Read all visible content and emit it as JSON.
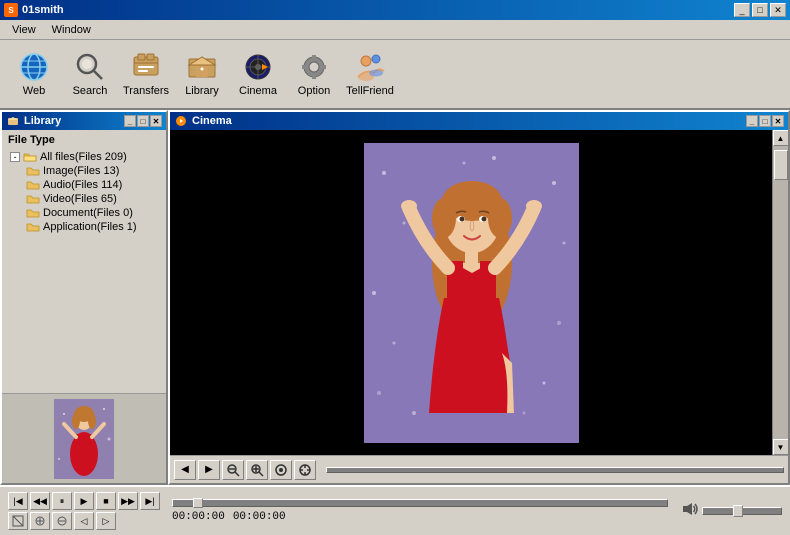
{
  "app": {
    "title": "01smith",
    "title_icon": "S"
  },
  "title_controls": {
    "minimize": "_",
    "maximize": "□",
    "close": "✕"
  },
  "menu": {
    "items": [
      {
        "id": "view",
        "label": "View"
      },
      {
        "id": "window",
        "label": "Window"
      }
    ]
  },
  "toolbar": {
    "buttons": [
      {
        "id": "web",
        "label": "Web",
        "icon": "web"
      },
      {
        "id": "search",
        "label": "Search",
        "icon": "search"
      },
      {
        "id": "transfers",
        "label": "Transfers",
        "icon": "transfers"
      },
      {
        "id": "library",
        "label": "Library",
        "icon": "library"
      },
      {
        "id": "cinema",
        "label": "Cinema",
        "icon": "cinema"
      },
      {
        "id": "option",
        "label": "Option",
        "icon": "option"
      },
      {
        "id": "tellfriend",
        "label": "TellFriend",
        "icon": "tellfriend"
      }
    ]
  },
  "library": {
    "title": "Library",
    "file_type_label": "File Type",
    "tree": {
      "root": {
        "label": "All files(Files 209)",
        "children": [
          {
            "label": "Image(Files 13)"
          },
          {
            "label": "Audio(Files 114)"
          },
          {
            "label": "Video(Files 65)"
          },
          {
            "label": "Document(Files 0)"
          },
          {
            "label": "Application(Files 1)"
          }
        ]
      }
    },
    "panel_controls": {
      "minimize": "_",
      "maximize": "□",
      "close": "✕"
    }
  },
  "cinema": {
    "title": "Cinema",
    "panel_controls": {
      "minimize": "_",
      "maximize": "□",
      "close": "✕"
    },
    "toolbar_buttons": [
      {
        "id": "back",
        "label": "◀"
      },
      {
        "id": "forward",
        "label": "▶"
      },
      {
        "id": "zoom-out",
        "label": "−"
      },
      {
        "id": "zoom-in",
        "label": "+"
      },
      {
        "id": "fit",
        "label": "⊡"
      },
      {
        "id": "fullscreen",
        "label": "⤢"
      }
    ]
  },
  "playback": {
    "controls_row1": [
      {
        "id": "prev-frame",
        "label": "|◀"
      },
      {
        "id": "step-back",
        "label": "◀◀"
      },
      {
        "id": "pause",
        "label": "⏸"
      },
      {
        "id": "play",
        "label": "▶"
      },
      {
        "id": "stop",
        "label": "■"
      },
      {
        "id": "step-fwd",
        "label": "▶▶"
      },
      {
        "id": "next-frame",
        "label": "▶|"
      }
    ],
    "controls_row2": [
      {
        "id": "btn1",
        "label": "⊠"
      },
      {
        "id": "btn2",
        "label": "⊕"
      },
      {
        "id": "btn3",
        "label": "⊖"
      },
      {
        "id": "btn4",
        "label": "◁"
      },
      {
        "id": "btn5",
        "label": "▷"
      }
    ],
    "time_current": "00:00:00",
    "time_total": "00:00:00",
    "volume_icon": "🔊"
  },
  "colors": {
    "titlebar_start": "#003087",
    "titlebar_end": "#1084d0",
    "bg": "#d4d0c8",
    "cinema_bg": "#000000",
    "accent_orange": "#ff6600"
  }
}
